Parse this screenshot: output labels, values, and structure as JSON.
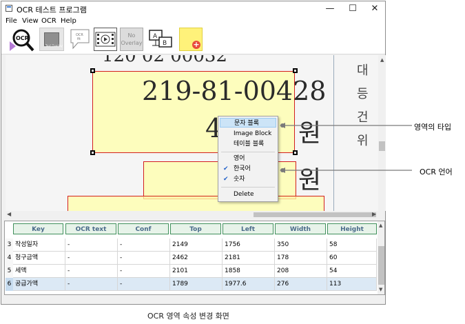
{
  "window": {
    "title": "OCR 테스트 프로그램"
  },
  "menubar": [
    "File",
    "View",
    "OCR",
    "Help"
  ],
  "toolbar": {
    "no_overlay": "No\nOverlay",
    "rect_label": "Text Overlay",
    "bubble_label": "OCR\nfit"
  },
  "document": {
    "partial_top": "120  02  00032",
    "line1": "219-81-00428",
    "line2": "4",
    "line2_suffix": "원",
    "line3_suffix": "원",
    "right_col": [
      "대",
      "등",
      "건",
      "위"
    ]
  },
  "context_menu": {
    "items": [
      {
        "label": "문자 블록",
        "checked": false,
        "highlighted": true
      },
      {
        "label": "Image Block",
        "checked": false,
        "highlighted": false
      },
      {
        "label": "테이블 블록",
        "checked": false,
        "highlighted": false
      },
      {
        "label": "영어",
        "checked": false,
        "highlighted": false
      },
      {
        "label": "한국어",
        "checked": true,
        "highlighted": false
      },
      {
        "label": "숫자",
        "checked": true,
        "highlighted": false
      },
      {
        "label": "Delete",
        "checked": false,
        "highlighted": false
      }
    ]
  },
  "table": {
    "columns": [
      "Key",
      "OCR text",
      "Conf",
      "Top",
      "Left",
      "Width",
      "Height"
    ],
    "rows": [
      {
        "num": "3",
        "cells": [
          "작성일자",
          "-",
          "-",
          "2149",
          "1756",
          "350",
          "58"
        ]
      },
      {
        "num": "4",
        "cells": [
          "청구금액",
          "-",
          "-",
          "2462",
          "2181",
          "178",
          "60"
        ]
      },
      {
        "num": "5",
        "cells": [
          "세액",
          "-",
          "-",
          "2101",
          "1858",
          "208",
          "54"
        ]
      },
      {
        "num": "6",
        "cells": [
          "공급가액",
          "-",
          "-",
          "1789",
          "1977.6",
          "276",
          "113"
        ]
      }
    ]
  },
  "annotations": {
    "region_type": "영역의 타입",
    "ocr_language": "OCR 언어"
  },
  "caption": "OCR 영역 속성 변경 화면"
}
